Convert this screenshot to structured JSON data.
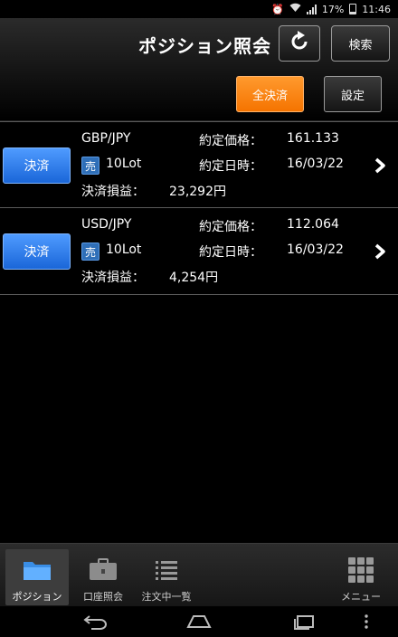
{
  "status_bar": {
    "battery": "17%",
    "time": "11:46"
  },
  "header": {
    "title": "ポジション照会",
    "search_label": "検索",
    "close_all_label": "全決済",
    "settings_label": "設定"
  },
  "labels": {
    "settle": "決済",
    "price_label": "約定価格：",
    "date_label": "約定日時：",
    "pl_label": "決済損益："
  },
  "positions": [
    {
      "pair": "GBP/JPY",
      "side": "売",
      "lot": "10Lot",
      "price": "161.133",
      "date": "16/03/22",
      "pl": "23,292円"
    },
    {
      "pair": "USD/JPY",
      "side": "売",
      "lot": "10Lot",
      "price": "112.064",
      "date": "16/03/22",
      "pl": "4,254円"
    }
  ],
  "bottom_nav": {
    "items": [
      {
        "label": "ポジション",
        "icon": "folder-icon",
        "active": true
      },
      {
        "label": "口座照会",
        "icon": "briefcase-icon",
        "active": false
      },
      {
        "label": "注文中一覧",
        "icon": "list-icon",
        "active": false
      },
      {
        "label": "メニュー",
        "icon": "grid-menu-icon",
        "active": false
      }
    ]
  },
  "colors": {
    "accent_orange": "#f57400",
    "settle_blue": "#1a66d8",
    "sell_badge": "#2f6fb8"
  }
}
